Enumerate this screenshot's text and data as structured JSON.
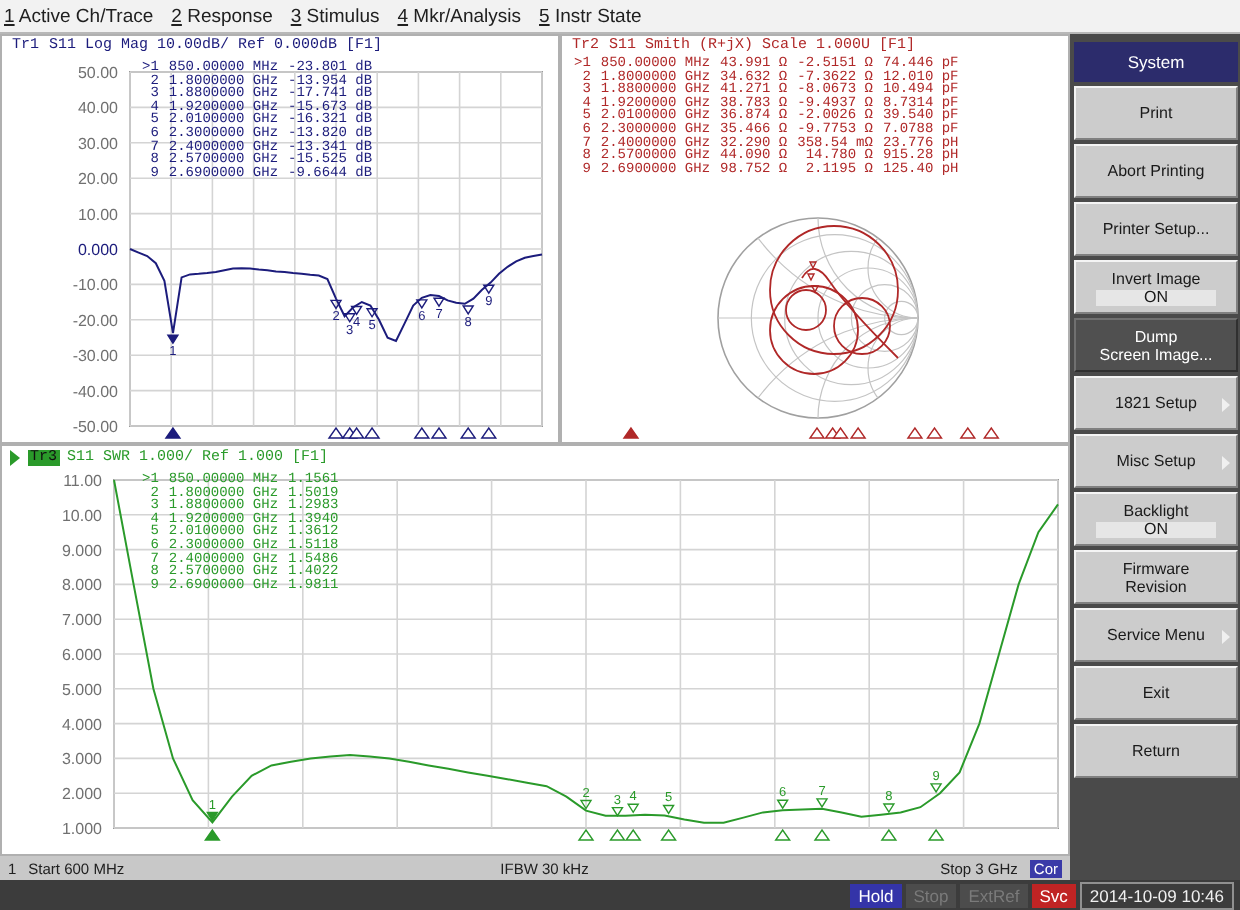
{
  "menu_bar": [
    {
      "key": "1",
      "label": "Active Ch/Trace"
    },
    {
      "key": "2",
      "label": "Response"
    },
    {
      "key": "3",
      "label": "Stimulus"
    },
    {
      "key": "4",
      "label": "Mkr/Analysis"
    },
    {
      "key": "5",
      "label": "Instr State"
    }
  ],
  "traces": [
    {
      "kind": "chart",
      "id": "Tr1",
      "title": "S11 Log Mag 10.00dB/ Ref 0.000dB [F1]",
      "active": false,
      "color": "#1c1c7c",
      "markers": [
        {
          "label": ">1",
          "stimulus": "850.00000 MHz",
          "values": [
            "-23.801 dB"
          ],
          "active": true
        },
        {
          "label": "2",
          "stimulus": "1.8000000 GHz",
          "values": [
            "-13.954 dB"
          ],
          "active": false
        },
        {
          "label": "3",
          "stimulus": "1.8800000 GHz",
          "values": [
            "-17.741 dB"
          ],
          "active": false
        },
        {
          "label": "4",
          "stimulus": "1.9200000 GHz",
          "values": [
            "-15.673 dB"
          ],
          "active": false
        },
        {
          "label": "5",
          "stimulus": "2.0100000 GHz",
          "values": [
            "-16.321 dB"
          ],
          "active": false
        },
        {
          "label": "6",
          "stimulus": "2.3000000 GHz",
          "values": [
            "-13.820 dB"
          ],
          "active": false
        },
        {
          "label": "7",
          "stimulus": "2.4000000 GHz",
          "values": [
            "-13.341 dB"
          ],
          "active": false
        },
        {
          "label": "8",
          "stimulus": "2.5700000 GHz",
          "values": [
            "-15.525 dB"
          ],
          "active": false
        },
        {
          "label": "9",
          "stimulus": "2.6900000 GHz",
          "values": [
            "-9.6644 dB"
          ],
          "active": false
        }
      ],
      "chart_data": {
        "type": "line",
        "ylim": [
          -50,
          50
        ],
        "yticks": [
          {
            "value": 50,
            "label": "50.00"
          },
          {
            "value": 40,
            "label": "40.00"
          },
          {
            "value": 30,
            "label": "30.00"
          },
          {
            "value": 20,
            "label": "20.00"
          },
          {
            "value": 10,
            "label": "10.00"
          },
          {
            "value": 0,
            "label": "0.000"
          },
          {
            "value": -10,
            "label": "-10.00"
          },
          {
            "value": -20,
            "label": "-20.00"
          },
          {
            "value": -30,
            "label": "-30.00"
          },
          {
            "value": -40,
            "label": "-40.00"
          },
          {
            "value": -50,
            "label": "-50.00"
          }
        ],
        "categories": [
          null,
          null,
          null,
          null,
          null,
          null,
          null,
          null,
          null,
          null,
          null,
          null,
          null,
          null,
          null,
          null,
          null,
          null,
          null,
          null,
          null,
          null,
          null,
          null,
          null,
          null,
          null,
          null,
          null,
          null,
          null,
          null,
          null,
          null,
          null,
          null,
          null,
          null,
          null,
          null,
          null,
          null,
          null,
          null,
          null,
          null,
          null,
          null,
          null
        ],
        "series": [
          {
            "color": "#1c1c7c",
            "values": [
              0,
              -1,
              -2,
              -4,
              -9,
              -23.8,
              -8,
              -7.2,
              -7,
              -6.8,
              -6.5,
              -6,
              -5.5,
              -5.4,
              -5.5,
              -5.8,
              -6,
              -6.3,
              -6.5,
              -6.8,
              -7,
              -7.3,
              -7.5,
              -8.5,
              -14,
              -19,
              -16.5,
              -15,
              -16,
              -20,
              -25,
              -26,
              -21,
              -16,
              -13.8,
              -13,
              -13.3,
              -14.5,
              -15.2,
              -15.5,
              -14,
              -11.5,
              -9.5,
              -7,
              -5,
              -3.5,
              -2.5,
              -2,
              -1.5
            ]
          }
        ],
        "grid": true,
        "annotations": [
          {
            "y": -23.801,
            "text": "1"
          },
          {
            "y": -13.954,
            "text": "2"
          },
          {
            "y": -17.741,
            "text": "3"
          },
          {
            "y": -15.673,
            "text": "4"
          },
          {
            "y": -16.321,
            "text": "5"
          },
          {
            "y": -13.82,
            "text": "6"
          },
          {
            "y": -13.341,
            "text": "7"
          },
          {
            "y": -15.525,
            "text": "8"
          },
          {
            "y": -9.6644,
            "text": "9"
          }
        ]
      }
    },
    {
      "kind": "smith",
      "id": "Tr2",
      "title": "S11 Smith (R+jX) Scale 1.000U [F1]",
      "active": false,
      "color": "#b02828",
      "markers": [
        {
          "label": ">1",
          "stimulus": "850.00000 MHz",
          "values": [
            "43.991 Ω",
            "-2.5151 Ω",
            "74.446 pF"
          ],
          "active": true
        },
        {
          "label": "2",
          "stimulus": "1.8000000 GHz",
          "values": [
            "34.632 Ω",
            "-7.3622 Ω",
            "12.010 pF"
          ],
          "active": false
        },
        {
          "label": "3",
          "stimulus": "1.8800000 GHz",
          "values": [
            "41.271 Ω",
            "-8.0673 Ω",
            "10.494 pF"
          ],
          "active": false
        },
        {
          "label": "4",
          "stimulus": "1.9200000 GHz",
          "values": [
            "38.783 Ω",
            "-9.4937 Ω",
            "8.7314 pF"
          ],
          "active": false
        },
        {
          "label": "5",
          "stimulus": "2.0100000 GHz",
          "values": [
            "36.874 Ω",
            "-2.0026 Ω",
            "39.540 pF"
          ],
          "active": false
        },
        {
          "label": "6",
          "stimulus": "2.3000000 GHz",
          "values": [
            "35.466 Ω",
            "-9.7753 Ω",
            "7.0788 pF"
          ],
          "active": false
        },
        {
          "label": "7",
          "stimulus": "2.4000000 GHz",
          "values": [
            "32.290 Ω",
            "358.54 mΩ",
            "23.776 pH"
          ],
          "active": false
        },
        {
          "label": "8",
          "stimulus": "2.5700000 GHz",
          "values": [
            "44.090 Ω",
            "14.780 Ω",
            "915.28 pH"
          ],
          "active": false
        },
        {
          "label": "9",
          "stimulus": "2.6900000 GHz",
          "values": [
            "98.752 Ω",
            "2.1195 Ω",
            "125.40 pH"
          ],
          "active": false
        }
      ]
    },
    {
      "kind": "chart",
      "id": "Tr3",
      "title": "S11 SWR 1.000/ Ref 1.000 [F1]",
      "active": true,
      "color": "#2a9a2a",
      "markers": [
        {
          "label": ">1",
          "stimulus": "850.00000 MHz",
          "values": [
            "1.1561"
          ],
          "active": true
        },
        {
          "label": "2",
          "stimulus": "1.8000000 GHz",
          "values": [
            "1.5019"
          ],
          "active": false
        },
        {
          "label": "3",
          "stimulus": "1.8800000 GHz",
          "values": [
            "1.2983"
          ],
          "active": false
        },
        {
          "label": "4",
          "stimulus": "1.9200000 GHz",
          "values": [
            "1.3940"
          ],
          "active": false
        },
        {
          "label": "5",
          "stimulus": "2.0100000 GHz",
          "values": [
            "1.3612"
          ],
          "active": false
        },
        {
          "label": "6",
          "stimulus": "2.3000000 GHz",
          "values": [
            "1.5118"
          ],
          "active": false
        },
        {
          "label": "7",
          "stimulus": "2.4000000 GHz",
          "values": [
            "1.5486"
          ],
          "active": false
        },
        {
          "label": "8",
          "stimulus": "2.5700000 GHz",
          "values": [
            "1.4022"
          ],
          "active": false
        },
        {
          "label": "9",
          "stimulus": "2.6900000 GHz",
          "values": [
            "1.9811"
          ],
          "active": false
        }
      ],
      "chart_data": {
        "type": "line",
        "ylim": [
          1,
          11
        ],
        "yticks": [
          {
            "value": 11,
            "label": "11.00"
          },
          {
            "value": 10,
            "label": "10.00"
          },
          {
            "value": 9,
            "label": "9.000"
          },
          {
            "value": 8,
            "label": "8.000"
          },
          {
            "value": 7,
            "label": "7.000"
          },
          {
            "value": 6,
            "label": "6.000"
          },
          {
            "value": 5,
            "label": "5.000"
          },
          {
            "value": 4,
            "label": "4.000"
          },
          {
            "value": 3,
            "label": "3.000"
          },
          {
            "value": 2,
            "label": "2.000"
          },
          {
            "value": 1,
            "label": "1.000"
          }
        ],
        "categories": [
          null,
          null,
          null,
          null,
          null,
          null,
          null,
          null,
          null,
          null,
          null,
          null,
          null,
          null,
          null,
          null,
          null,
          null,
          null,
          null,
          null,
          null,
          null,
          null,
          null,
          null,
          null,
          null,
          null,
          null,
          null,
          null,
          null,
          null,
          null,
          null,
          null,
          null,
          null,
          null,
          null,
          null,
          null,
          null,
          null,
          null,
          null,
          null,
          null
        ],
        "series": [
          {
            "color": "#2a9a2a",
            "values": [
              11,
              8,
              5,
              3,
              1.8,
              1.16,
              1.9,
              2.5,
              2.8,
              2.9,
              3,
              3.05,
              3.1,
              3.05,
              3,
              2.9,
              2.8,
              2.7,
              2.6,
              2.5,
              2.4,
              2.3,
              2.2,
              1.9,
              1.5,
              1.35,
              1.35,
              1.38,
              1.36,
              1.25,
              1.15,
              1.15,
              1.3,
              1.45,
              1.51,
              1.53,
              1.55,
              1.45,
              1.32,
              1.38,
              1.45,
              1.6,
              2,
              2.6,
              4,
              6,
              8,
              9.5,
              10.3
            ]
          }
        ],
        "grid": true,
        "annotations": [
          {
            "y": 1.1561,
            "text": "1"
          },
          {
            "y": 1.5019,
            "text": "2"
          },
          {
            "y": 1.2983,
            "text": "3"
          },
          {
            "y": 1.394,
            "text": "4"
          },
          {
            "y": 1.3612,
            "text": "5"
          },
          {
            "y": 1.5118,
            "text": "6"
          },
          {
            "y": 1.5486,
            "text": "7"
          },
          {
            "y": 1.4022,
            "text": "8"
          },
          {
            "y": 1.9811,
            "text": "9"
          }
        ]
      }
    }
  ],
  "channel_status": {
    "channel": "1",
    "start": "Start 600 MHz",
    "ifbw": "IFBW 30 kHz",
    "stop": "Stop 3 GHz",
    "correction": "Cor"
  },
  "softkeys": {
    "title": "System",
    "items": [
      {
        "label": "Print",
        "submenu": false,
        "selected": false
      },
      {
        "label": "Abort Printing",
        "submenu": false,
        "selected": false
      },
      {
        "label": "Printer Setup...",
        "submenu": false,
        "selected": false
      },
      {
        "label": "Invert Image",
        "value": "ON",
        "submenu": false,
        "selected": false
      },
      {
        "label": "Dump\nScreen Image...",
        "submenu": false,
        "selected": true
      },
      {
        "label": "1821 Setup",
        "submenu": true,
        "selected": false
      },
      {
        "label": "Misc Setup",
        "submenu": true,
        "selected": false
      },
      {
        "label": "Backlight",
        "value": "ON",
        "submenu": false,
        "selected": false
      },
      {
        "label": "Firmware\nRevision",
        "submenu": false,
        "selected": false
      },
      {
        "label": "Service Menu",
        "submenu": true,
        "selected": false
      },
      {
        "label": "Exit",
        "submenu": false,
        "selected": false
      },
      {
        "label": "Return",
        "submenu": false,
        "selected": false
      }
    ]
  },
  "status_bar": [
    {
      "label": "Hold",
      "kind": "on"
    },
    {
      "label": "Stop",
      "kind": "off"
    },
    {
      "label": "ExtRef",
      "kind": "off"
    },
    {
      "label": "Svc",
      "kind": "alert"
    },
    {
      "label": "2014-10-09 10:46",
      "kind": "clock"
    }
  ]
}
